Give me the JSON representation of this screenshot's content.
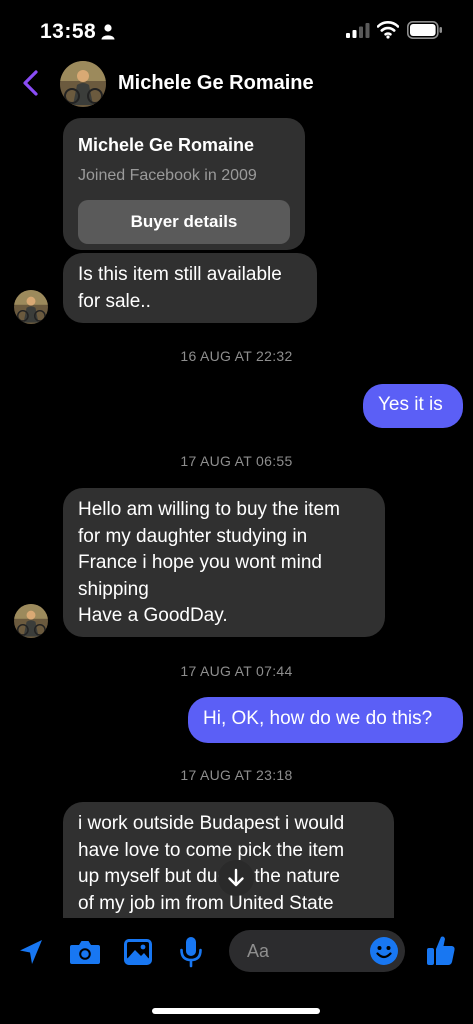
{
  "status_bar": {
    "time": "13:58"
  },
  "header": {
    "name": "Michele Ge Romaine"
  },
  "profile_card": {
    "name": "Michele Ge Romaine",
    "subtitle": "Joined Facebook in 2009",
    "button_label": "Buyer details"
  },
  "messages": [
    {
      "lines": [
        "Is this item still available",
        "for sale.."
      ]
    },
    {
      "timestamp": "16 AUG AT 22:32"
    },
    {
      "lines": [
        "Yes it is"
      ]
    },
    {
      "timestamp": "17 AUG AT 06:55"
    },
    {
      "lines": [
        "Hello am willing to buy the item",
        "for my daughter studying in",
        "France i hope you wont mind",
        "shipping",
        "Have a GoodDay."
      ]
    },
    {
      "timestamp": "17 AUG AT 07:44"
    },
    {
      "lines": [
        "Hi, OK, how do we do this?"
      ]
    },
    {
      "timestamp": "17 AUG AT 23:18"
    },
    {
      "lines": [
        "i work outside Budapest i would",
        "have love to come pick the item",
        "up myself but due to the nature",
        "of my job im from United State"
      ]
    }
  ],
  "composer": {
    "placeholder": "Aa"
  },
  "colors": {
    "accent": "#5b5ff6",
    "icon_blue": "#1877f2",
    "incoming_bg": "#303030",
    "back_purple": "#8a4cf6"
  }
}
